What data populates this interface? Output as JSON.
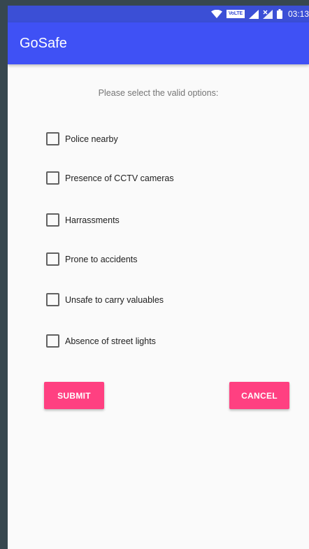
{
  "status_bar": {
    "network_label": "VoLTE",
    "time": "03:13",
    "icons": [
      "wifi-icon",
      "volte-icon",
      "signal-icon",
      "signal-no-sim-icon",
      "battery-icon"
    ]
  },
  "app_bar": {
    "title": "GoSafe"
  },
  "form": {
    "prompt": "Please select the valid options:",
    "options": [
      {
        "label": "Police nearby",
        "checked": false
      },
      {
        "label": "Presence of CCTV cameras",
        "checked": false
      },
      {
        "label": "Harrassments",
        "checked": false
      },
      {
        "label": "Prone to accidents",
        "checked": false
      },
      {
        "label": "Unsafe to carry valuables",
        "checked": false
      },
      {
        "label": "Absence of street lights",
        "checked": false
      }
    ],
    "submit_label": "SUBMIT",
    "cancel_label": "CANCEL"
  },
  "colors": {
    "status_bar": "#3b4fd6",
    "app_bar": "#3f51f5",
    "accent": "#ff4081",
    "background": "#fafafa"
  }
}
